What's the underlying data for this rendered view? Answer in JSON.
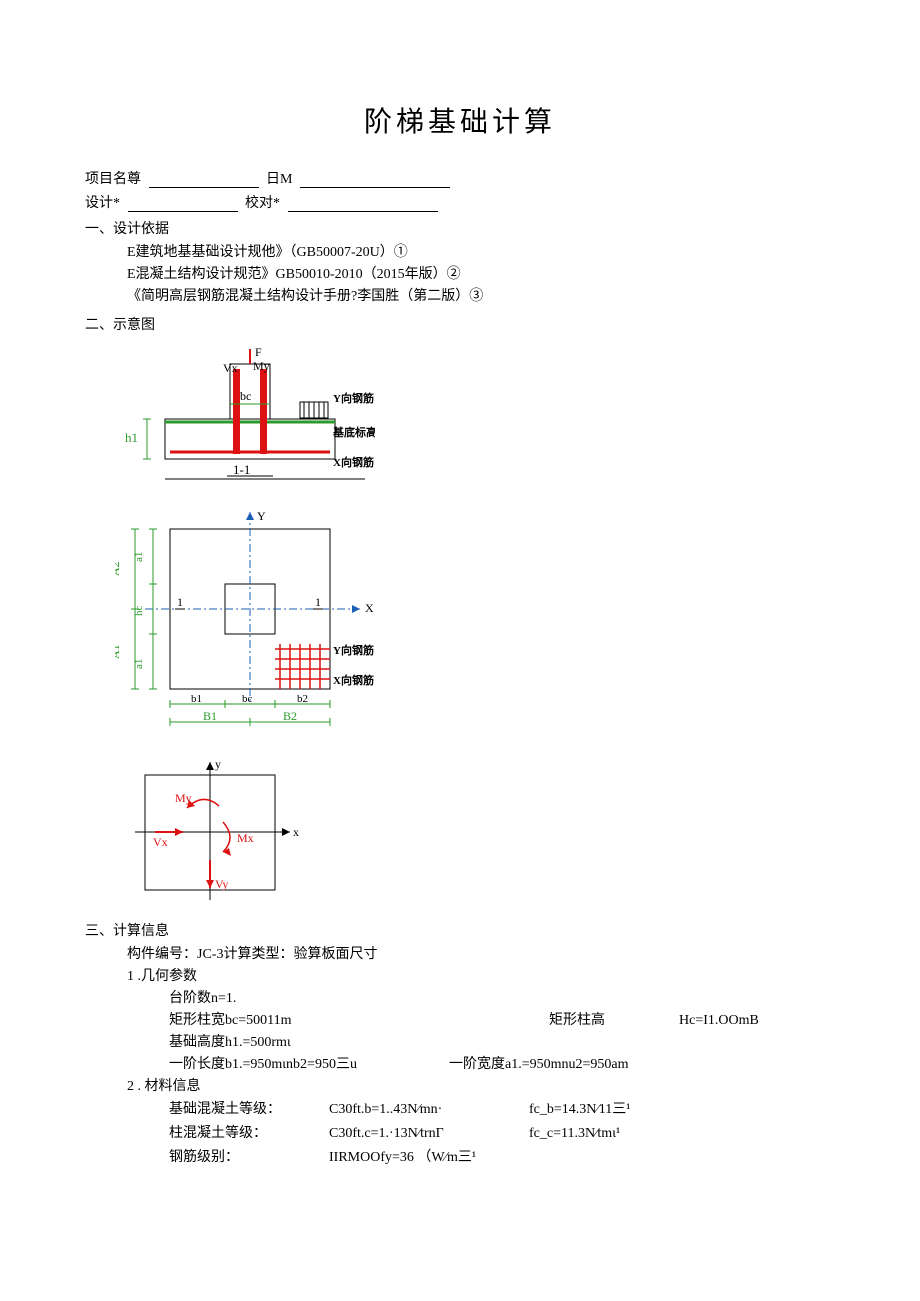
{
  "title": "阶梯基础计算",
  "header": {
    "project_label": "项目名尊",
    "date_label": "日M",
    "design_label": "设计*",
    "proof_label": "校对*"
  },
  "sec1": {
    "heading": "一、设计依据",
    "line1": "E建筑地基基础设计规他》（GB50007-20U）①",
    "line2": "E混凝土结构设计规范》GB50010-2010（2015年版）②",
    "line3": "《简明高层钢筋混凝土结构设计手册?李国胜（第二版）③"
  },
  "sec2": {
    "heading": "二、示意图",
    "labels": {
      "F": "F",
      "Vx": "Vx",
      "My": "My",
      "bc": "bc",
      "h1": "h1",
      "y_rebar": "Y向钢筋",
      "base_elev": "基底标高",
      "section": "1-1",
      "x_rebar": "X向钢筋",
      "Y": "Y",
      "X": "X",
      "A2": "A2",
      "A1": "A1",
      "a1": "a1",
      "a2": "a2",
      "hc": "hc",
      "one": "1",
      "b1": "b1",
      "b2": "b2",
      "B1": "B1",
      "B2": "B2",
      "y_rebar2": "Y向钢筋",
      "x_rebar2": "X向钢筋",
      "yaxis": "y",
      "xaxis": "x",
      "Mx": "Mx",
      "My2": "My",
      "Vx2": "Vx",
      "Vy": "Vy"
    }
  },
  "sec3": {
    "heading": "三、计算信息",
    "component": "构件编号：JC-3计算类型：验算板面尺寸",
    "sub1": "1  .几何参数",
    "step_count": "台阶数n=1.",
    "col_width_lbl": "矩形柱宽bc=50011m",
    "col_height_lbl": "矩形柱高",
    "col_height_val": "Hc=I1.OOmB",
    "base_height": "基础高度h1.=500rmι",
    "len1": "一阶长度b1.=950mιnb2=950三u",
    "wid1": "一阶宽度a1.=950mnu2=950am",
    "sub2": "2   . 材料信息",
    "base_conc_lbl": "基础混凝土等级：",
    "base_conc_val1": "C30ft.b=1..43N⁄mn·",
    "base_conc_val2": "fc_b=14.3N⁄11三¹",
    "col_conc_lbl": "柱混凝土等级：",
    "col_conc_val1": "C30ft.c=1.·13N⁄trnΓ",
    "col_conc_val2": "fc_c=11.3N⁄tmι¹",
    "rebar_lbl": "钢筋级别：",
    "rebar_val": "IIRMOOfy=36 （W⁄m三¹"
  }
}
